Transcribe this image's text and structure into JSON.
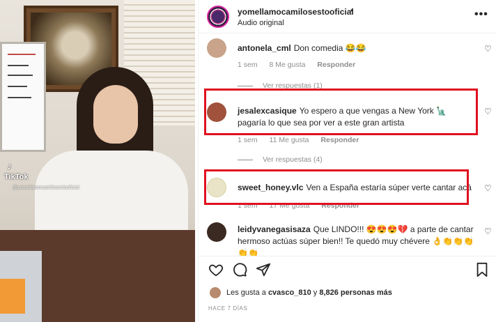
{
  "media": {
    "tiktok_label": "TikTok",
    "tiktok_user": "@yomellamocamilosestooficial"
  },
  "header": {
    "username": "yomellamocamilosestooficial",
    "dot": "•",
    "audio": "Audio original",
    "more": "•••"
  },
  "comments": [
    {
      "user": "antonela_cml",
      "text": "Don comedia 😂😂",
      "time": "1 sem",
      "likes": "8 Me gusta",
      "reply": "Responder",
      "view_replies": "Ver respuestas (1)",
      "avatar_color": "#c9a48a"
    },
    {
      "user": "jesalexcasique",
      "text": "Yo espero a que vengas a New York 🗽 pagaría lo que sea por ver a este gran artista",
      "time": "1 sem",
      "likes": "11 Me gusta",
      "reply": "Responder",
      "view_replies": "Ver respuestas (4)",
      "avatar_color": "#a0523c"
    },
    {
      "user": "sweet_honey.vlc",
      "text": "Ven a España estaría súper verte cantar acá",
      "time": "1 sem",
      "likes": "17 Me gusta",
      "reply": "Responder",
      "view_replies": "",
      "avatar_color": "#e9e4c8"
    },
    {
      "user": "leidyvanegasisaza",
      "text": "Que LINDO!!! 😍😍😍💔 a parte de cantar hermoso actúas súper bien!! Te quedó muy chévere 👌👏👏👏 👏👏",
      "time": "",
      "likes": "",
      "reply": "",
      "view_replies": "",
      "avatar_color": "#3a2a22"
    }
  ],
  "actions": {
    "like_icon": "heart-icon",
    "comment_icon": "comment-icon",
    "share_icon": "send-icon",
    "save_icon": "bookmark-icon"
  },
  "likes": {
    "prefix": "Les gusta a",
    "user": "cvasco_810",
    "middle": "y",
    "count": "8,826 personas más"
  },
  "date": "HACE 7 DÍAS",
  "colors": {
    "highlight": "#e0101f",
    "text": "#262626",
    "muted": "#8e8e8e"
  }
}
